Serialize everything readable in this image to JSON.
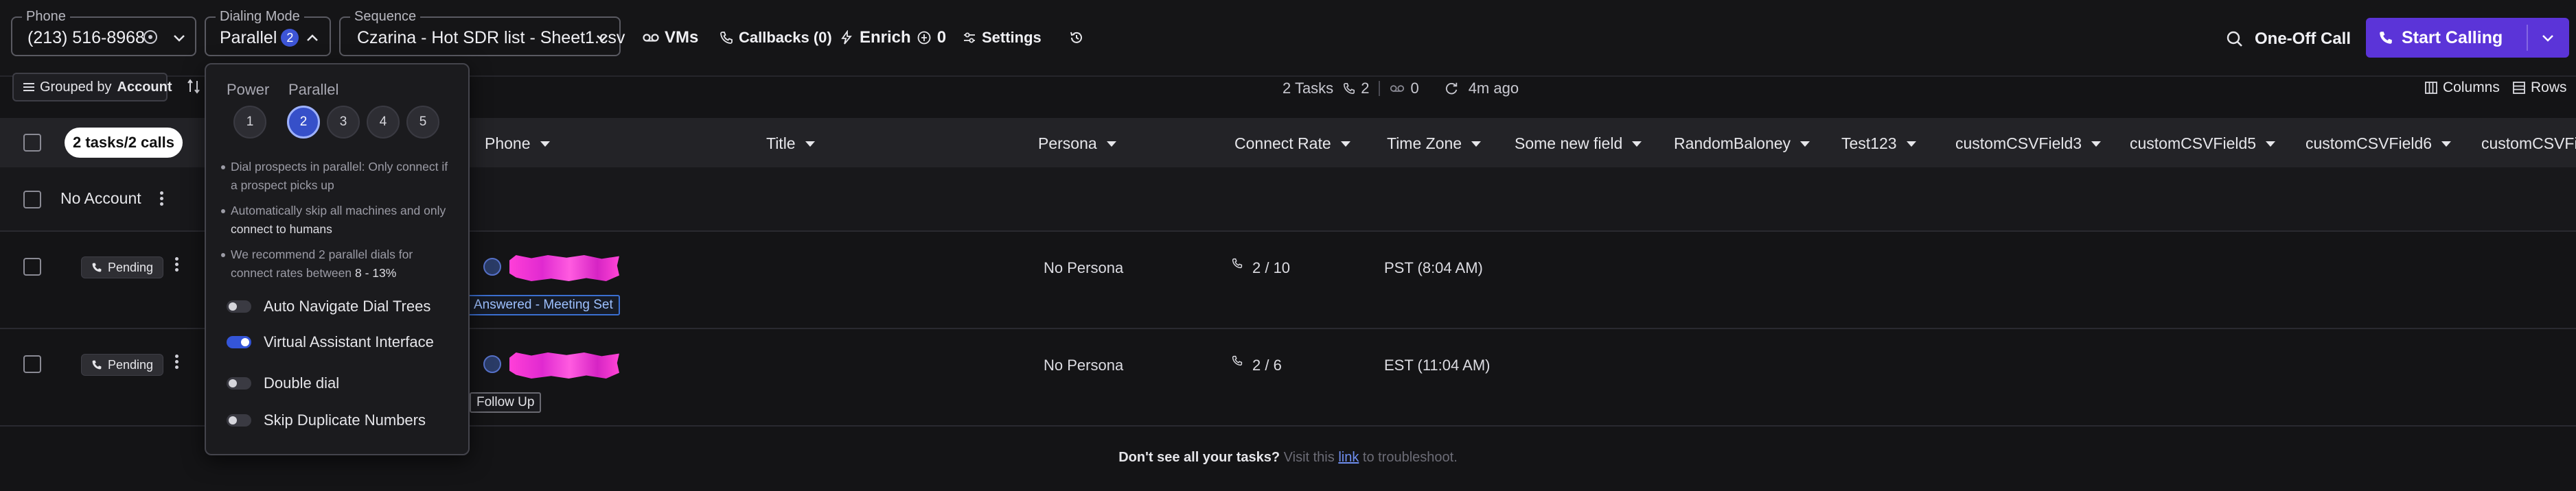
{
  "topbar": {
    "phone": {
      "legend": "Phone",
      "value": "(213) 516-8968"
    },
    "dialing_mode": {
      "legend": "Dialing Mode",
      "value": "Parallel",
      "count": "2"
    },
    "sequence": {
      "legend": "Sequence",
      "value": "Czarina - Hot SDR list - Sheet1.csv"
    },
    "vms_label": "VMs",
    "callbacks_label": "Callbacks (0)",
    "enrich_label": "Enrich",
    "enrich_count": "0",
    "settings_label": "Settings",
    "one_off_call_label": "One-Off Call",
    "start_calling_label": "Start Calling"
  },
  "toolbar": {
    "grouped_by_prefix": "Grouped by",
    "grouped_by_value": "Account",
    "tasks_text": "2 Tasks",
    "calls_count": "2",
    "vm_count": "0",
    "refreshed_ago": "4m ago",
    "columns_label": "Columns",
    "rows_label": "Rows"
  },
  "table": {
    "summary_pill": "2 tasks/2 calls",
    "columns": [
      "Phone",
      "Title",
      "Persona",
      "Connect Rate",
      "Time Zone",
      "Some new field",
      "RandomBaloney",
      "Test123",
      "customCSVField3",
      "customCSVField5",
      "customCSVField6",
      "customCSVFie"
    ],
    "group_label": "No Account",
    "rows": [
      {
        "status": "Pending",
        "persona": "No Persona",
        "connect_rate": "2 / 10",
        "time_zone": "PST (8:04 AM)",
        "disposition": "Answered - Meeting Set"
      },
      {
        "status": "Pending",
        "persona": "No Persona",
        "connect_rate": "2 / 6",
        "time_zone": "EST (11:04 AM)",
        "disposition": "Follow Up"
      }
    ]
  },
  "footer": {
    "question": "Don't see all your tasks?",
    "visit_text": "Visit this",
    "link_text": "link",
    "tail_text": "to troubleshoot."
  },
  "popover": {
    "power_label": "Power",
    "parallel_label": "Parallel",
    "numbers": [
      "1",
      "2",
      "3",
      "4",
      "5"
    ],
    "selected": "2",
    "bullets": [
      {
        "text": "Dial prospects in parallel: Only connect if a prospect picks up"
      },
      {
        "text": "Automatically skip all machines and only",
        "highlight": "connect to humans"
      },
      {
        "text": "We recommend 2 parallel dials for connect rates between",
        "highlight": "8 - 13%"
      }
    ],
    "toggles": [
      {
        "label": "Auto Navigate Dial Trees",
        "on": false
      },
      {
        "label": "Virtual Assistant Interface",
        "on": true
      },
      {
        "label": "Double dial",
        "on": false
      },
      {
        "label": "Skip Duplicate Numbers",
        "on": false
      }
    ]
  },
  "colors": {
    "accent": "#5b34d8",
    "selected_blue": "#3650c9",
    "redaction": "#ff3fd8"
  }
}
